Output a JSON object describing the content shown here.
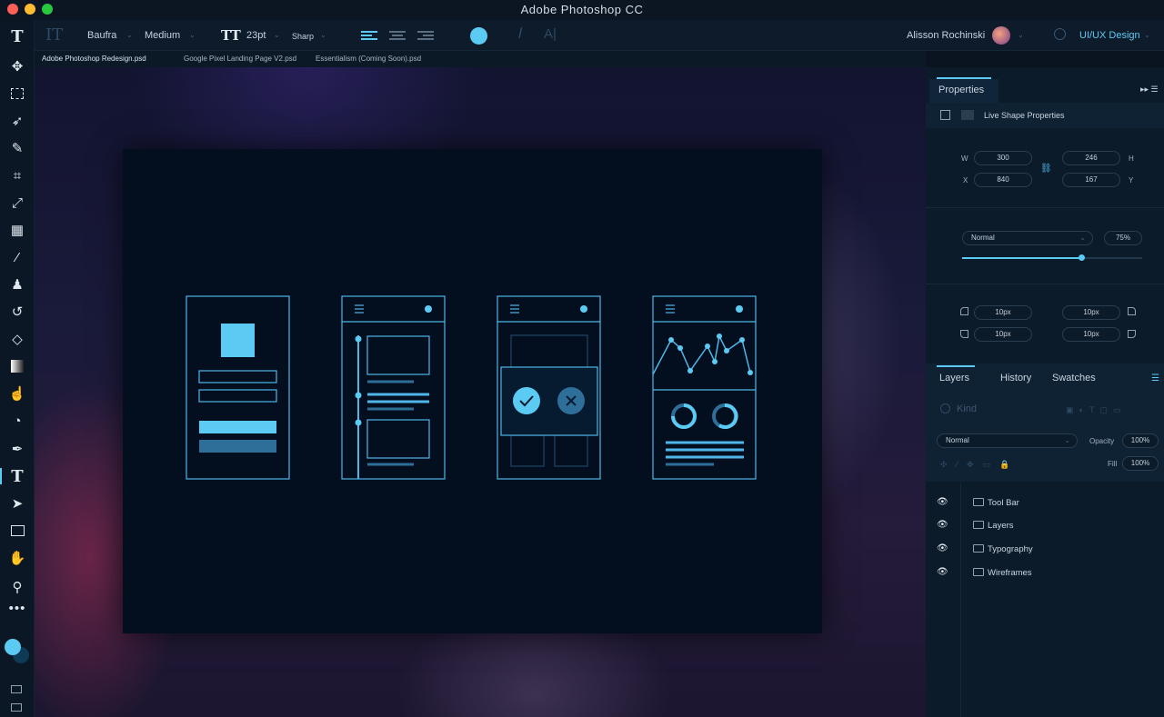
{
  "window": {
    "title": "Adobe Photoshop CC",
    "controls": [
      "close",
      "minimize",
      "zoom"
    ],
    "control_colors": [
      "#fe5f57",
      "#febc2e",
      "#28c840"
    ]
  },
  "options_bar": {
    "font_family": "Baufra",
    "font_weight": "Medium",
    "font_size": "23pt",
    "antialias": "Sharp",
    "user_name": "Alisson Rochinski",
    "workspace": "UI/UX Design",
    "accent_color": "#5ccbf4"
  },
  "tabs": [
    {
      "label": "Adobe Photoshop Redesign.psd"
    },
    {
      "label": "Google Pixel Landing Page V2.psd"
    },
    {
      "label": "Essentialism (Coming Soon).psd"
    }
  ],
  "toolbox": {
    "tools": [
      "type-icon",
      "move-icon",
      "marquee-icon",
      "lasso-icon",
      "quick-select-icon",
      "crop-icon",
      "eyedropper-icon",
      "healing-icon",
      "brush-icon",
      "stamp-icon",
      "history-brush-icon",
      "eraser-icon",
      "gradient-icon",
      "smudge-icon",
      "dodge-icon",
      "pen-icon",
      "type-icon",
      "path-select-icon",
      "rectangle-icon",
      "hand-icon",
      "zoom-icon",
      "more-icon"
    ],
    "foreground_color": "#5ccbf4",
    "background_color": "#0e3a55"
  },
  "properties": {
    "tab": "Properties",
    "subtitle": "Live Shape Properties",
    "w_label": "W",
    "w": "300",
    "h_label": "H",
    "h": "246",
    "x_label": "X",
    "x": "840",
    "y_label": "Y",
    "y": "167",
    "blend": "Normal",
    "opacity": "75%",
    "opacity_value": 0.66,
    "corners": [
      "10px",
      "10px",
      "10px",
      "10px"
    ]
  },
  "layers_panel": {
    "tabs": [
      "Layers",
      "History",
      "Swatches"
    ],
    "filter_placeholder": "Kind",
    "blend": "Normal",
    "opacity_label": "Opacity",
    "opacity": "100%",
    "fill_label": "Fill",
    "fill": "100%",
    "layers": [
      {
        "name": "Tool Bar"
      },
      {
        "name": "Layers"
      },
      {
        "name": "Typography"
      },
      {
        "name": "Wireframes"
      }
    ]
  },
  "wireframe_color": "#4fb6e8"
}
